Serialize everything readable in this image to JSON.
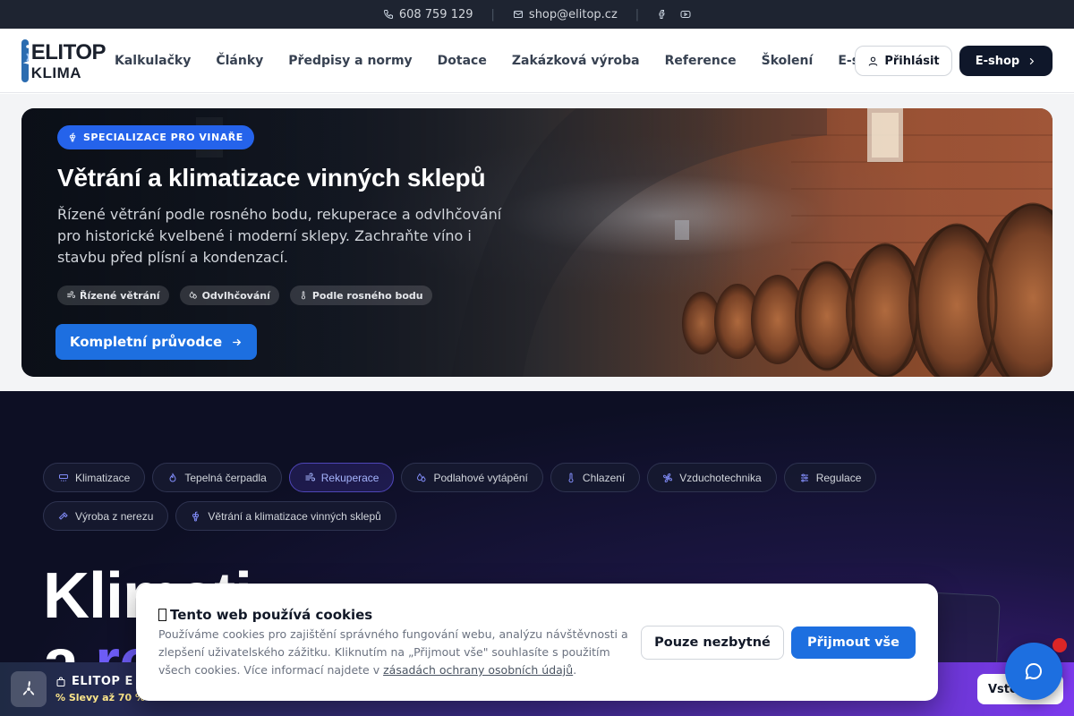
{
  "topbar": {
    "phone": "608 759 129",
    "email": "shop@elitop.cz",
    "socials": [
      "facebook-icon",
      "youtube-icon"
    ]
  },
  "header": {
    "logo": {
      "line1": "ELITOP",
      "line2": "KLIMA"
    },
    "nav": [
      "Kalkulačky",
      "Články",
      "Předpisy a normy",
      "Dotace",
      "Zakázková výroba",
      "Reference",
      "Školení",
      "E-shop"
    ],
    "login_label": "Přihlásit",
    "shop_label": "E-shop"
  },
  "hero": {
    "badge": "SPECIALIZACE PRO VINAŘE",
    "title": "Větrání a klimatizace vinných sklepů",
    "subtitle": "Řízené větrání podle rosného bodu, rekuperace a odvlhčování pro historické kvelbené i moderní sklepy. Zachraňte víno i stavbu před plísní a kondenzací.",
    "tags": [
      "Řízené větrání",
      "Odvlhčování",
      "Podle rosného bodu"
    ],
    "cta": "Kompletní průvodce"
  },
  "categories": {
    "items": [
      {
        "label": "Klimatizace",
        "icon": "ac-icon"
      },
      {
        "label": "Tepelná čerpadla",
        "icon": "flame-icon"
      },
      {
        "label": "Rekuperace",
        "icon": "wind-icon",
        "active": true
      },
      {
        "label": "Podlahové vytápění",
        "icon": "drops-icon"
      },
      {
        "label": "Chlazení",
        "icon": "thermometer-icon"
      },
      {
        "label": "Vzduchotechnika",
        "icon": "fan-icon"
      },
      {
        "label": "Regulace",
        "icon": "sliders-icon"
      },
      {
        "label": "Výroba z nerezu",
        "icon": "hammer-icon"
      },
      {
        "label": "Větrání a klimatizace vinných sklepů",
        "icon": "grapes-icon"
      }
    ]
  },
  "big_title": {
    "line1": "Klimati",
    "line2_a": "a ",
    "line2_b": "re"
  },
  "promo": {
    "title": "ELITOP E",
    "subtitle": "% Slevy až 70 %",
    "button": "Vsto"
  },
  "cookie": {
    "title": "Tento web používá cookies",
    "text": "Používáme cookies pro zajištění správného fungování webu, analýzu návštěvnosti a zlepšení uživatelského zážitku. Kliknutím na „Přijmout vše\" souhlasíte s použitím všech cookies. Více informací najdete v ",
    "link": "zásadách ochrany osobních údajů",
    "text_end": ".",
    "necessary_label": "Pouze nezbytné",
    "accept_label": "Přijmout vše"
  },
  "colors": {
    "primary": "#1d6fe0",
    "dark_bg": "#0d0f24",
    "accent_purple": "#6d5cf6"
  }
}
